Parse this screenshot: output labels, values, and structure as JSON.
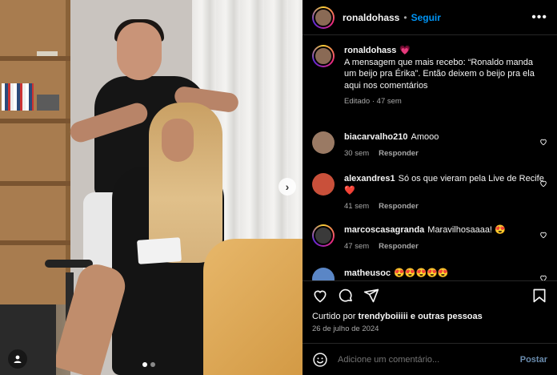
{
  "post": {
    "username": "ronaldohass",
    "follow_label": "Seguir",
    "separator": "•",
    "more_label": "•••",
    "caption_user": "ronaldohass",
    "caption_emoji": "💗",
    "caption_text": "A mensagem que mais recebo: “Ronaldo manda um beijo pra Érika”. Então deixem o beijo pra ela aqui nos comentários",
    "caption_meta": "Editado · 47 sem"
  },
  "comments": [
    {
      "user": "biacarvalho210",
      "text": "Amooo",
      "age": "30 sem",
      "reply": "Responder",
      "avatar_color": "#9a7a64"
    },
    {
      "user": "alexandres1",
      "text": "Só os que vieram pela Live de Recife ❤️",
      "age": "41 sem",
      "reply": "Responder",
      "avatar_color": "#c9503a"
    },
    {
      "user": "marcoscasagranda",
      "text": "Maravilhosaaaa! 😍",
      "age": "47 sem",
      "reply": "Responder",
      "avatar_color": "#3a3a3a"
    },
    {
      "user": "matheusoc",
      "text": "😍😍😍😍😍",
      "age": "",
      "reply": "",
      "avatar_color": "#5a86c6"
    }
  ],
  "likes": {
    "prefix": "Curtido por",
    "user": "trendyboiiiii",
    "suffix": "e outras pessoas"
  },
  "date": "26 de julho de 2024",
  "composer": {
    "placeholder": "Adicione um comentário...",
    "post_label": "Postar"
  },
  "icons": [
    "heart-icon",
    "comment-icon",
    "share-icon",
    "bookmark-icon",
    "emoji-icon",
    "user-tag-icon",
    "chevron-right-icon",
    "more-icon"
  ],
  "colors": {
    "link_blue": "#0095f6",
    "muted": "#a8a8a8",
    "background": "#000000",
    "post_disabled": "#6a8cae"
  }
}
